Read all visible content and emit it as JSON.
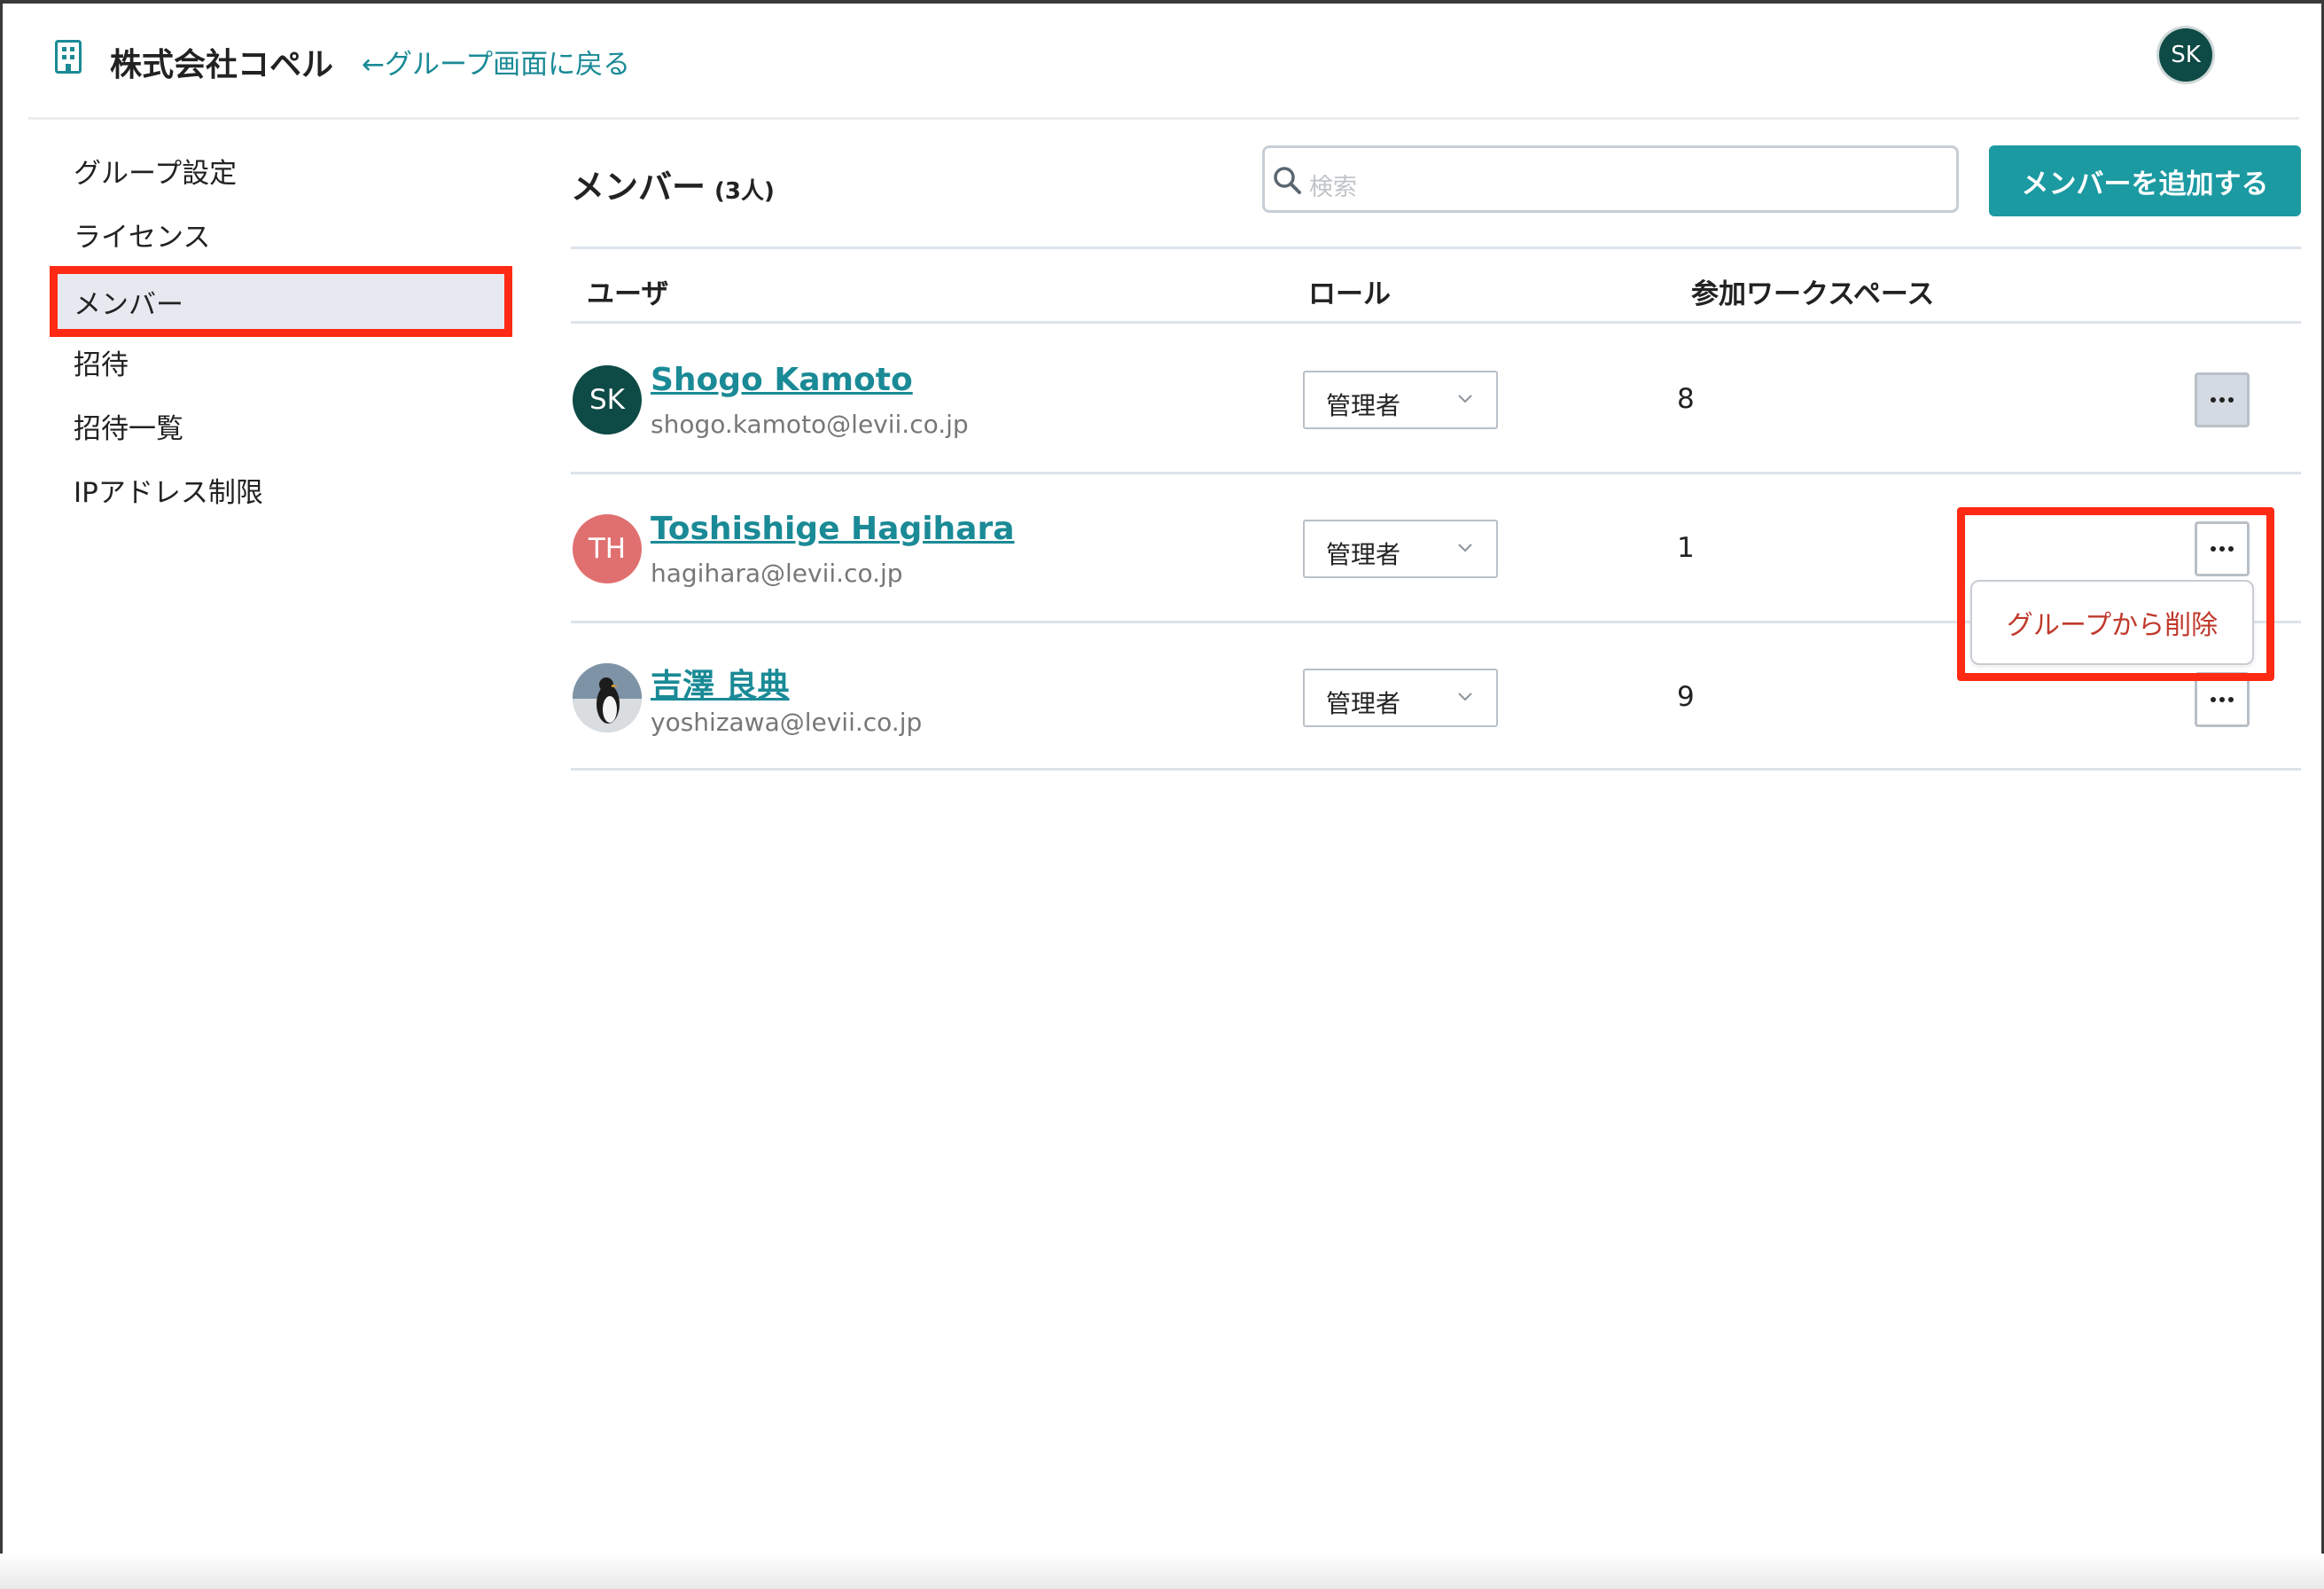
{
  "header": {
    "brand": "株式会社コペル",
    "back_link": "←グループ画面に戻る",
    "user_initials": "SK"
  },
  "sidebar": {
    "items": [
      {
        "label": "グループ設定"
      },
      {
        "label": "ライセンス"
      },
      {
        "label": "メンバー",
        "active": true
      },
      {
        "label": "招待"
      },
      {
        "label": "招待一覧"
      },
      {
        "label": "IPアドレス制限"
      }
    ]
  },
  "main": {
    "title": "メンバー",
    "count": "(3人)",
    "search": {
      "placeholder": "検索",
      "value": ""
    },
    "add_button": "メンバーを追加する",
    "columns": [
      "ユーザ",
      "ロール",
      "参加ワークスペース"
    ],
    "rows": [
      {
        "initials": "SK",
        "avatar_color": "#0e4a46",
        "name": "Shogo Kamoto",
        "email": "shogo.kamoto@levii.co.jp",
        "role": "管理者",
        "workspaces": "8"
      },
      {
        "initials": "TH",
        "avatar_color": "#e07070",
        "name": "Toshishige Hagihara",
        "email": "hagihara@levii.co.jp",
        "role": "管理者",
        "workspaces": "1"
      },
      {
        "initials": "",
        "avatar_color": "#8da0b0",
        "name": "吉澤 良典",
        "email": "yoshizawa@levii.co.jp",
        "role": "管理者",
        "workspaces": "9"
      }
    ],
    "context_menu": {
      "item": "グループから削除"
    }
  },
  "colors": {
    "accent": "#1b9aa2",
    "link": "#1a8a96",
    "highlight": "#ff2a14",
    "danger_text": "#c0392b"
  }
}
